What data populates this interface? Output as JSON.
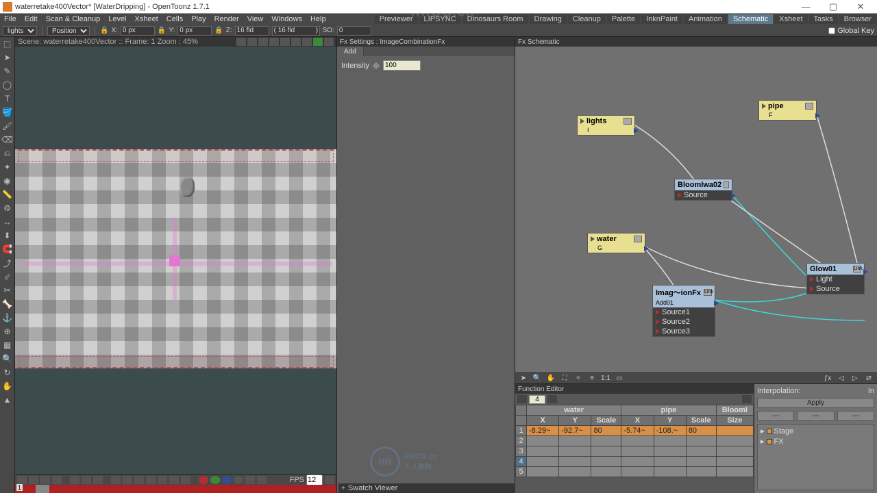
{
  "title": "waterretake400Vector* [WaterDripping] - OpenToonz 1.7.1",
  "menu": [
    "File",
    "Edit",
    "Scan & Cleanup",
    "Level",
    "Xsheet",
    "Cells",
    "Play",
    "Render",
    "View",
    "Windows",
    "Help"
  ],
  "rooms": [
    "Previewer",
    "LIPSYNC",
    "Dinosaurs Room",
    "Drawing",
    "Cleanup",
    "Palette",
    "InknPaint",
    "Animation",
    "Schematic",
    "Xsheet",
    "Tasks",
    "Browser"
  ],
  "rooms_active": "Schematic",
  "toolbar": {
    "levelsel": "lights",
    "mode": "Position",
    "xlbl": "X:",
    "xval": "0 px",
    "ylbl": "Y:",
    "yval": "0 px",
    "zlbl": "Z:",
    "zval": "16 fld",
    "paren": "( 16 fld           )",
    "solbl": "SO:",
    "soval": "0",
    "globalkey": "Global Key"
  },
  "viewer": {
    "scene_info": "Scene: waterretake400Vector   ::   Frame: 1   Zoom : 45%",
    "fps_lbl": "FPS",
    "fps": "12",
    "frame": "1"
  },
  "fxsettings": {
    "hdr": "Fx Settings : ImageCombinationFx",
    "tab": "Add",
    "intensity_lbl": "Intensity",
    "intensity_val": "100"
  },
  "schematic": {
    "hdr": "Fx Schematic",
    "nodes": {
      "lights": {
        "name": "lights",
        "sub": "I"
      },
      "pipe": {
        "name": "pipe",
        "sub": "F"
      },
      "water": {
        "name": "water",
        "sub": "G"
      },
      "bloom": {
        "name": "BloomIwa02",
        "src": "Source"
      },
      "imgfx": {
        "name": "Imag～ionFx",
        "sub": "Add01",
        "sources": [
          "Source1",
          "Source2",
          "Source3"
        ],
        "link": "Link"
      },
      "glow": {
        "name": "Glow01",
        "link": "Link",
        "ports": [
          "Light",
          "Source"
        ]
      }
    },
    "tb_11": "1:1"
  },
  "funced": {
    "hdr": "Function Editor",
    "frame": "4",
    "groups": [
      "water",
      "pipe",
      "BloomI"
    ],
    "cols": [
      "X",
      "Y",
      "Scale",
      "X",
      "Y",
      "Scale",
      "Size"
    ],
    "row1": [
      "-8.29~",
      "-92.7~",
      "80",
      "-5.74~",
      "-108.~",
      "80",
      ""
    ],
    "interp_lbl": "Interpolation:",
    "in_lbl": "In",
    "apply": "Apply",
    "stage": "Stage",
    "fx": "FX"
  },
  "swatch": "Swatch Viewer",
  "watermark": "RRCG.cn"
}
